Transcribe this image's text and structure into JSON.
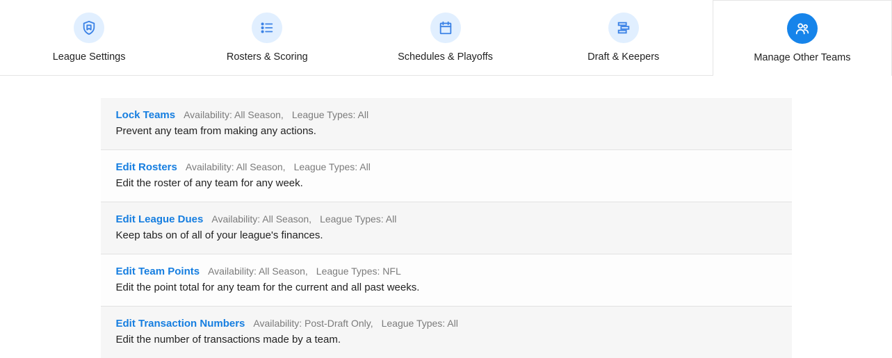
{
  "tabs": [
    {
      "label": "League Settings",
      "icon": "bookmark-shield",
      "active": false
    },
    {
      "label": "Rosters & Scoring",
      "icon": "list",
      "active": false
    },
    {
      "label": "Schedules & Playoffs",
      "icon": "calendar",
      "active": false
    },
    {
      "label": "Draft & Keepers",
      "icon": "stack",
      "active": false
    },
    {
      "label": "Manage Other Teams",
      "icon": "people",
      "active": true
    }
  ],
  "rows": [
    {
      "title": "Lock Teams",
      "availability": "Availability: All Season,",
      "league_types": "League Types: All",
      "desc": "Prevent any team from making any actions."
    },
    {
      "title": "Edit Rosters",
      "availability": "Availability: All Season,",
      "league_types": "League Types: All",
      "desc": "Edit the roster of any team for any week."
    },
    {
      "title": "Edit League Dues",
      "availability": "Availability: All Season,",
      "league_types": "League Types: All",
      "desc": "Keep tabs on of all of your league's finances."
    },
    {
      "title": "Edit Team Points",
      "availability": "Availability: All Season,",
      "league_types": "League Types: NFL",
      "desc": "Edit the point total for any team for the current and all past weeks."
    },
    {
      "title": "Edit Transaction Numbers",
      "availability": "Availability: Post-Draft Only,",
      "league_types": "League Types: All",
      "desc": "Edit the number of transactions made by a team."
    }
  ]
}
